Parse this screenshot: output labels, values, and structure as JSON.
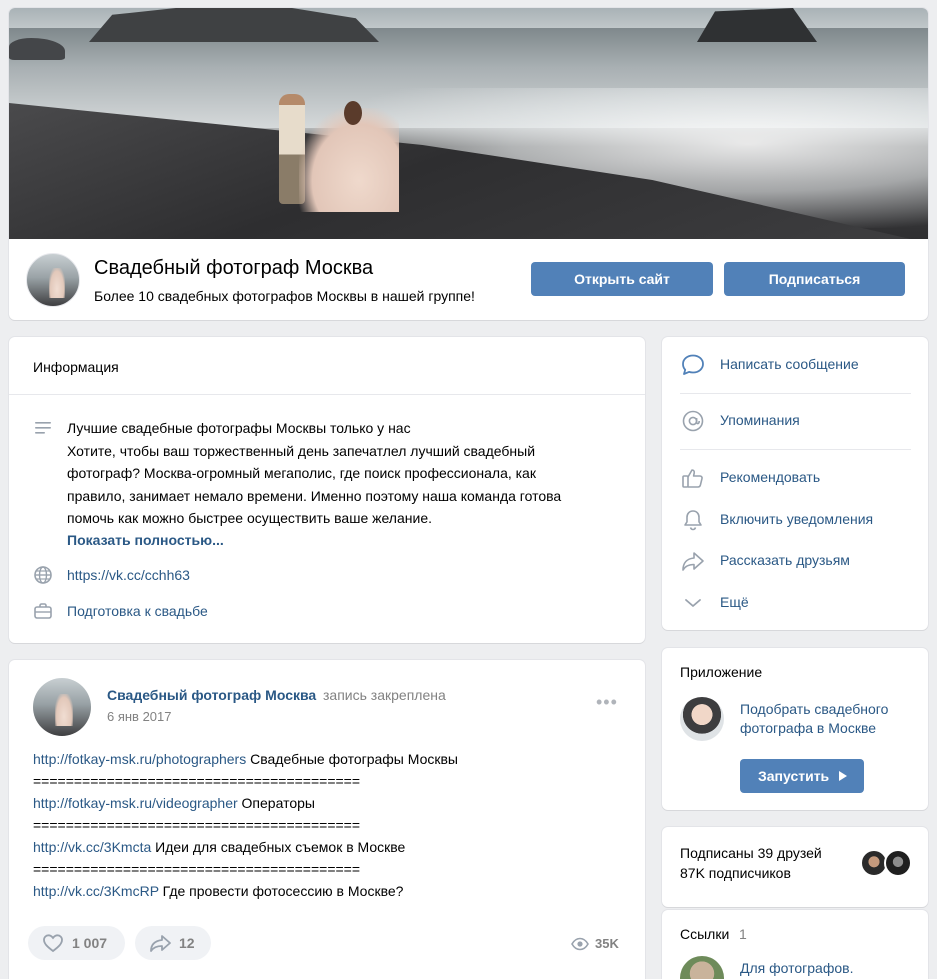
{
  "group": {
    "title": "Свадебный фотограф Москва",
    "status": "Более 10 свадебных фотографов Москвы в нашей группе!",
    "open_site_label": "Открыть сайт",
    "subscribe_label": "Подписаться"
  },
  "info": {
    "heading": "Информация",
    "description_lines": [
      "Лучшие свадебные фотографы Москвы только у нас",
      "Хотите, чтобы ваш торжественный день запечатлел лучший свадебный",
      "фотограф? Москва-огромный мегаполис, где поиск профессионала, как",
      "правило, занимает немало времени. Именно поэтому наша команда готова",
      "помочь как можно быстрее осуществить ваше желание."
    ],
    "show_more": "Показать полностью...",
    "site": "https://vk.cc/cchh63",
    "category": "Подготовка к свадьбе"
  },
  "post": {
    "author": "Свадебный фотограф Москва",
    "pinned": "запись закреплена",
    "date": "6 янв 2017",
    "menu": "•••",
    "lines": [
      {
        "link": "http://fotkay-msk.ru/photographers",
        "text": " Свадебные фотографы Москвы"
      },
      {
        "link": "",
        "text": "========================================"
      },
      {
        "link": "http://fotkay-msk.ru/videographer",
        "text": " Операторы"
      },
      {
        "link": "",
        "text": "========================================"
      },
      {
        "link": "http://vk.cc/3Kmcta",
        "text": " Идеи для свадебных съемок в Москве"
      },
      {
        "link": "",
        "text": "========================================"
      },
      {
        "link": "http://vk.cc/3KmcRP",
        "text": " Где провести фотосессию в Москве?"
      }
    ],
    "likes": "1 007",
    "shares": "12",
    "views": "35K"
  },
  "actions": {
    "items": [
      {
        "label": "Написать сообщение",
        "icon": "message-icon"
      },
      {
        "label": "Упоминания",
        "icon": "at-icon"
      },
      {
        "label": "Рекомендовать",
        "icon": "thumb-up-icon"
      },
      {
        "label": "Включить уведомления",
        "icon": "bell-icon"
      },
      {
        "label": "Рассказать друзьям",
        "icon": "share-icon"
      },
      {
        "label": "Ещё",
        "icon": "chevron-down-icon"
      }
    ]
  },
  "app": {
    "heading": "Приложение",
    "name": "Подобрать свадебного фотографа в Москве",
    "run_label": "Запустить"
  },
  "followers": {
    "friends": "Подписаны 39 друзей",
    "subscribers": "87K подписчиков"
  },
  "links": {
    "heading": "Ссылки",
    "count": "1",
    "first": "Для фотографов."
  },
  "colors": {
    "accent": "#5181b8",
    "link": "#2a5885",
    "background": "#edeef0",
    "muted": "#828282"
  }
}
